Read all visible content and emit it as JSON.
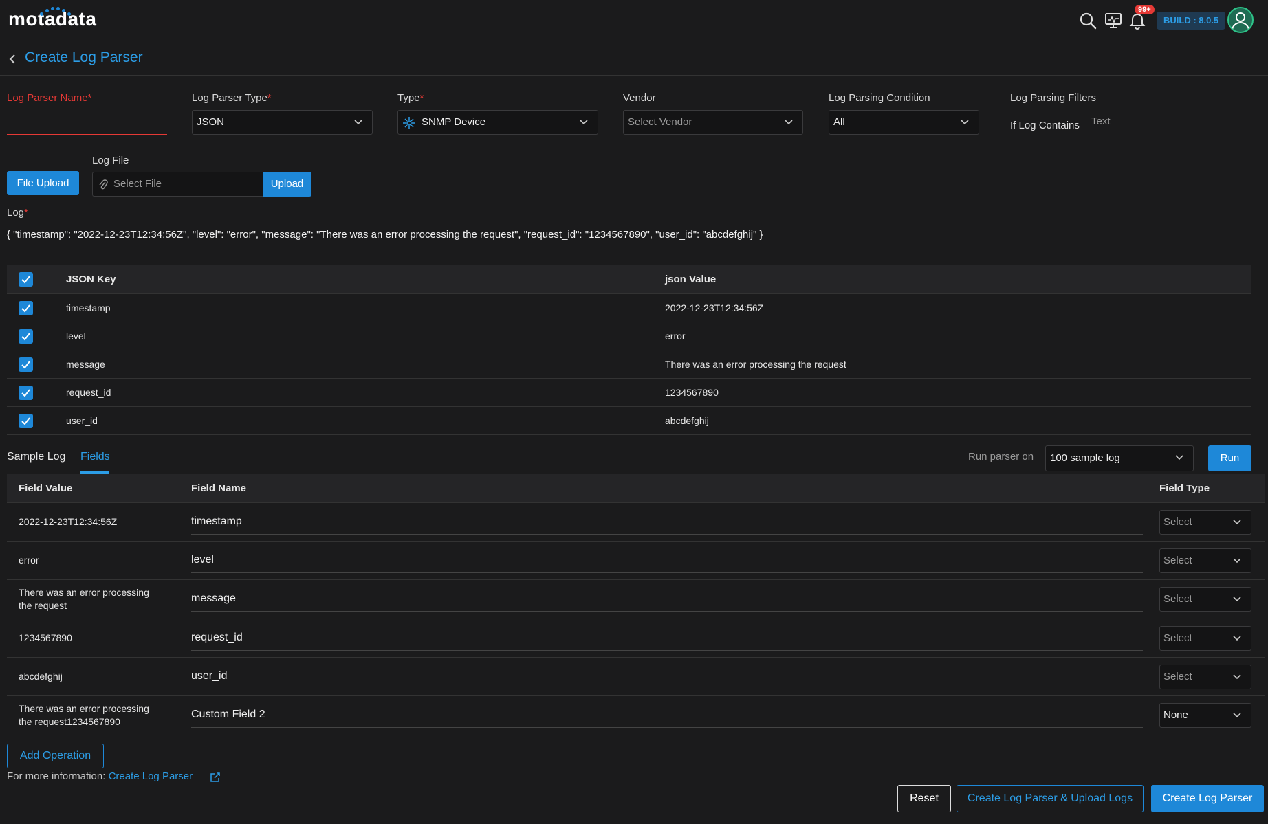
{
  "app": {
    "logo_text": "motadata",
    "notification_count": "99+",
    "build": "BUILD : 8.0.5"
  },
  "header": {
    "title": "Create Log Parser"
  },
  "form": {
    "parser_name_label": "Log Parser Name",
    "parser_type_label": "Log Parser Type",
    "parser_type_value": "JSON",
    "type_label": "Type",
    "type_value": "SNMP Device",
    "vendor_label": "Vendor",
    "vendor_placeholder": "Select Vendor",
    "condition_label": "Log Parsing Condition",
    "condition_value": "All",
    "filters_label": "Log Parsing Filters",
    "filter_if_label": "If Log Contains",
    "filter_placeholder": "Text",
    "required_mark": "*",
    "file_upload_button": "File Upload",
    "log_file_label": "Log File",
    "select_file_placeholder": "Select File",
    "upload_button": "Upload",
    "log_label": "Log",
    "log_value": "{ \"timestamp\": \"2022-12-23T12:34:56Z\", \"level\": \"error\", \"message\": \"There was an error processing the request\", \"request_id\": \"1234567890\", \"user_id\": \"abcdefghij\" }"
  },
  "json_table": {
    "headers": {
      "key": "JSON Key",
      "value": "json Value"
    },
    "rows": [
      {
        "key": "timestamp",
        "value": "2022-12-23T12:34:56Z",
        "checked": true
      },
      {
        "key": "level",
        "value": "error",
        "checked": true
      },
      {
        "key": "message",
        "value": "There was an error processing the request",
        "checked": true
      },
      {
        "key": "request_id",
        "value": "1234567890",
        "checked": true
      },
      {
        "key": "user_id",
        "value": "abcdefghij",
        "checked": true
      }
    ]
  },
  "tabs": [
    {
      "label": "Sample Log",
      "active": false
    },
    {
      "label": "Fields",
      "active": true
    }
  ],
  "run": {
    "label": "Run parser on",
    "selected": "100 sample log",
    "button": "Run"
  },
  "fields_table": {
    "headers": {
      "value": "Field Value",
      "name": "Field Name",
      "type": "Field Type"
    },
    "rows": [
      {
        "value": "2022-12-23T12:34:56Z",
        "name": "timestamp",
        "type": "Select"
      },
      {
        "value": "error",
        "name": "level",
        "type": "Select"
      },
      {
        "value": "There was an error processing the request",
        "name": "message",
        "type": "Select"
      },
      {
        "value": "1234567890",
        "name": "request_id",
        "type": "Select"
      },
      {
        "value": "abcdefghij",
        "name": "user_id",
        "type": "Select"
      },
      {
        "value": "There was an error processing the request1234567890",
        "name": "Custom Field 2",
        "type": "None"
      }
    ]
  },
  "footer": {
    "add_operation": "Add Operation",
    "more_info_prefix": "For more information:",
    "more_info_link": "Create Log Parser",
    "reset": "Reset",
    "create_and_upload": "Create Log Parser & Upload Logs",
    "create": "Create Log Parser"
  },
  "colors": {
    "accent": "#1e88d8",
    "required": "#e53935",
    "background": "#1b1b1c"
  }
}
